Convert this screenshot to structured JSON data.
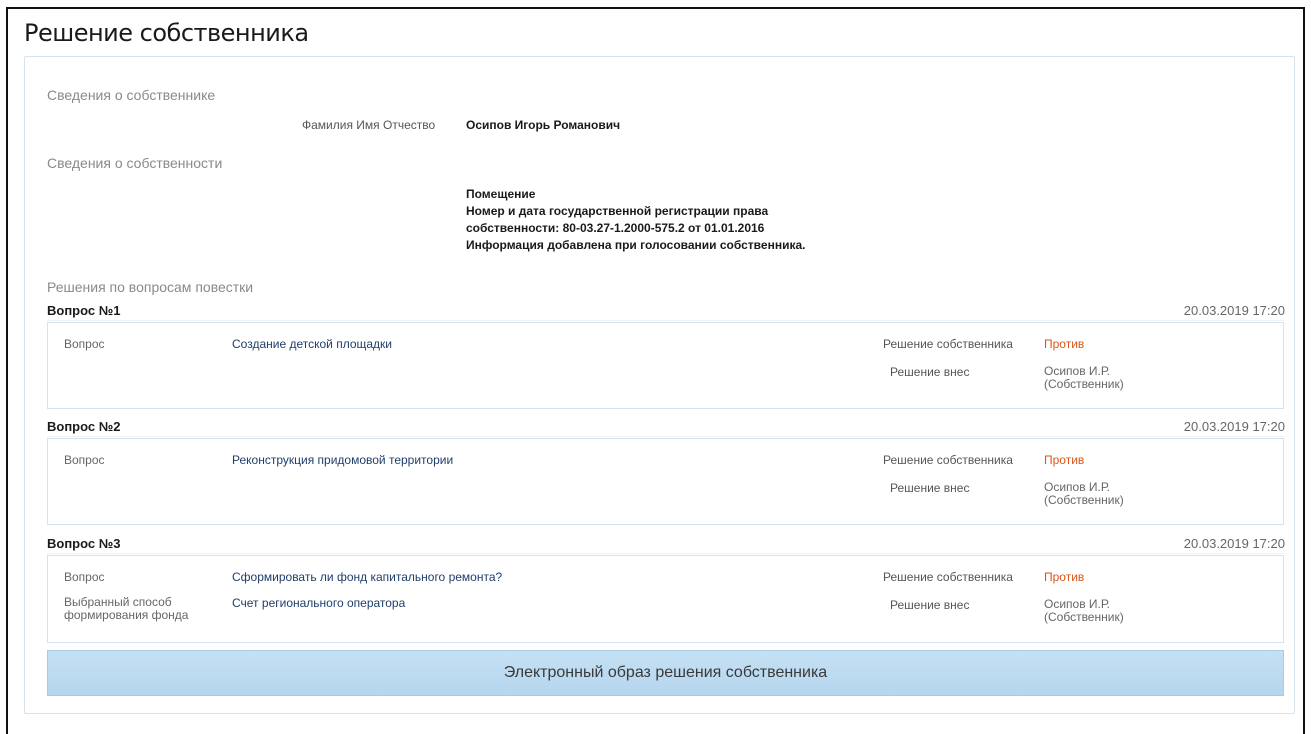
{
  "page": {
    "title": "Решение собственника"
  },
  "owner": {
    "section_title": "Сведения о собственнике",
    "name_label": "Фамилия Имя Отчество",
    "name_value": "Осипов Игорь Романович"
  },
  "property": {
    "section_title": "Сведения о собственности",
    "lines": [
      "Помещение",
      "Номер и дата государственной регистрации права",
      "собственности: 80-03.27-1.2000-575.2 от 01.01.2016",
      "Информация добавлена при голосовании собственника."
    ]
  },
  "agenda": {
    "section_title": "Решения по вопросам повестки",
    "questions": [
      {
        "header": "Вопрос №1",
        "date": "20.03.2019 17:20",
        "question_label": "Вопрос",
        "question_text": "Создание детской площадки",
        "decision_label": "Решение собственника",
        "decision_value": "Против",
        "by_label": "Решение внес",
        "by_value_1": "Осипов И.Р.",
        "by_value_2": "(Собственник)"
      },
      {
        "header": "Вопрос №2",
        "date": "20.03.2019 17:20",
        "question_label": "Вопрос",
        "question_text": "Реконструкция придомовой территории",
        "decision_label": "Решение собственника",
        "decision_value": "Против",
        "by_label": "Решение внес",
        "by_value_1": "Осипов И.Р.",
        "by_value_2": "(Собственник)"
      },
      {
        "header": "Вопрос №3",
        "date": "20.03.2019 17:20",
        "question_label": "Вопрос",
        "question_text": "Сформировать ли фонд капитального ремонта?",
        "method_label_1": "Выбранный способ",
        "method_label_2": "формирования фонда",
        "method_value": "Счет регионального оператора",
        "decision_label": "Решение собственника",
        "decision_value": "Против",
        "by_label": "Решение внес",
        "by_value_1": "Осипов И.Р.",
        "by_value_2": "(Собственник)"
      }
    ]
  },
  "image_button": {
    "label": "Электронный образ решения собственника"
  },
  "colors": {
    "decision": "#d9561a",
    "button_bg": "#c5e0f4",
    "link_text": "#1f3e6b"
  }
}
